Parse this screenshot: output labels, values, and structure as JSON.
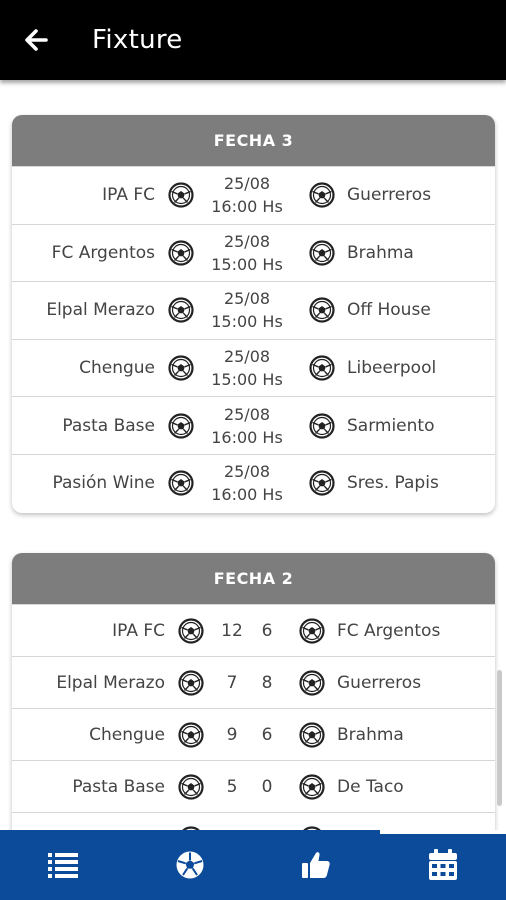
{
  "header": {
    "title": "Fixture"
  },
  "rounds": [
    {
      "label": "FECHA 3",
      "matches": [
        {
          "home": "IPA FC",
          "away": "Guerreros",
          "date": "25/08",
          "time": "16:00 Hs"
        },
        {
          "home": "FC Argentos",
          "away": "Brahma",
          "date": "25/08",
          "time": "15:00 Hs"
        },
        {
          "home": "Elpal Merazo",
          "away": "Off House",
          "date": "25/08",
          "time": "15:00 Hs"
        },
        {
          "home": "Chengue",
          "away": "Libeerpool",
          "date": "25/08",
          "time": "15:00 Hs"
        },
        {
          "home": "Pasta Base",
          "away": "Sarmiento",
          "date": "25/08",
          "time": "16:00 Hs"
        },
        {
          "home": "Pasión Wine",
          "away": "Sres. Papis",
          "date": "25/08",
          "time": "16:00 Hs"
        }
      ]
    },
    {
      "label": "FECHA 2",
      "matches": [
        {
          "home": "IPA FC",
          "away": "FC Argentos",
          "home_score": "12",
          "away_score": "6"
        },
        {
          "home": "Elpal Merazo",
          "away": "Guerreros",
          "home_score": "7",
          "away_score": "8"
        },
        {
          "home": "Chengue",
          "away": "Brahma",
          "home_score": "9",
          "away_score": "6"
        },
        {
          "home": "Pasta Base",
          "away": "De Taco",
          "home_score": "5",
          "away_score": "0"
        },
        {
          "home": "",
          "away": "",
          "home_score": "",
          "away_score": ""
        }
      ]
    }
  ],
  "bottom_nav": [
    {
      "icon": "list-icon",
      "active": false
    },
    {
      "icon": "soccer-ball-icon",
      "active": false
    },
    {
      "icon": "thumbs-up-icon",
      "active": false
    },
    {
      "icon": "calendar-icon",
      "active": true
    }
  ],
  "colors": {
    "appbar": "#000000",
    "header_bar": "#7d7d7d",
    "bottom_nav": "#0c4a9a"
  }
}
